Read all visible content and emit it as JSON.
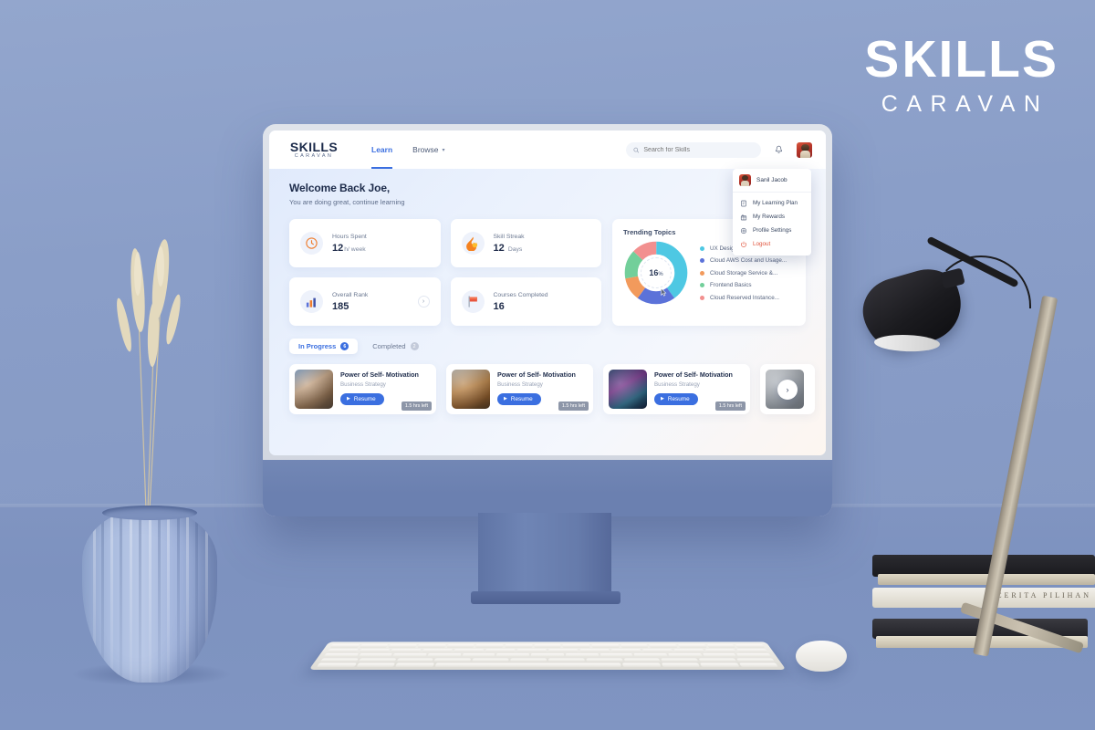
{
  "brand_overlay": {
    "line1": "SKILLS",
    "line2": "CARAVAN"
  },
  "app": {
    "logo": {
      "line1": "SKILLS",
      "line2": "CARAVAN"
    },
    "nav": [
      {
        "label": "Learn",
        "active": true
      },
      {
        "label": "Browse",
        "active": false,
        "caret": "chevron-down"
      }
    ],
    "search": {
      "placeholder": "Search for Skills",
      "value": "",
      "icon": "search-icon"
    },
    "notifications_icon": "bell-icon",
    "avatar_icon": "user-avatar"
  },
  "dropdown": {
    "user_name": "Sanil Jacob",
    "items": [
      {
        "label": "My Learning Plan",
        "icon": "note-icon"
      },
      {
        "label": "My Rewards",
        "icon": "gift-icon"
      },
      {
        "label": "Profile Settings",
        "icon": "gear-icon"
      },
      {
        "label": "Logout",
        "icon": "power-icon",
        "danger": true
      }
    ]
  },
  "welcome": {
    "title": "Welcome Back Joe,",
    "subtitle": "You are doing great, continue learning"
  },
  "stats": [
    {
      "label": "Hours Spent",
      "value": "12",
      "unit": "h/ week",
      "icon": "clock-icon",
      "chevron": false
    },
    {
      "label": "Skill Streak",
      "value": "12",
      "unit": "Days",
      "icon": "fire-icon",
      "chevron": false
    },
    {
      "label": "Overall Rank",
      "value": "185",
      "unit": "",
      "icon": "bar-chart-icon",
      "chevron": true
    },
    {
      "label": "Courses Completed",
      "value": "16",
      "unit": "",
      "icon": "flag-icon",
      "chevron": false
    }
  ],
  "trending": {
    "title": "Trending Topics",
    "center_value": "16",
    "center_unit": "%"
  },
  "chart_data": {
    "type": "pie",
    "title": "Trending Topics",
    "center_label": "16%",
    "categories": [
      "UX Design",
      "Cloud AWS Cost and Usage...",
      "Cloud Storage Service &...",
      "Frontend Basics",
      "Cloud Reserved Instance..."
    ],
    "values": [
      40,
      20,
      12,
      15,
      13
    ],
    "colors": [
      "#4ec8e3",
      "#5b72d9",
      "#f29a5c",
      "#72cf9a",
      "#f2908f"
    ],
    "legend_position": "right",
    "donut": true
  },
  "tabs": [
    {
      "label": "In Progress",
      "count": "6",
      "active": true
    },
    {
      "label": "Completed",
      "count": "2",
      "active": false
    }
  ],
  "courses": [
    {
      "title": "Power of Self- Motivation",
      "category": "Business Strategy",
      "action": "Resume",
      "time_left": "1.5 hrs left",
      "thumb": "t1"
    },
    {
      "title": "Power of Self- Motivation",
      "category": "Business Strategy",
      "action": "Resume",
      "time_left": "1.5 hrs left",
      "thumb": "t2"
    },
    {
      "title": "Power of Self- Motivation",
      "category": "Business Strategy",
      "action": "Resume",
      "time_left": "1.5 hrs left",
      "thumb": "t3"
    }
  ],
  "carousel": {
    "next_icon": "chevron-right-icon"
  },
  "books": {
    "spine_title": "CERITA PILIHAN"
  },
  "colors": {
    "accent": "#3b6fe0",
    "danger": "#e0533b",
    "scene_bg": "#8499c6",
    "imac_chin": "#6b80b0"
  }
}
